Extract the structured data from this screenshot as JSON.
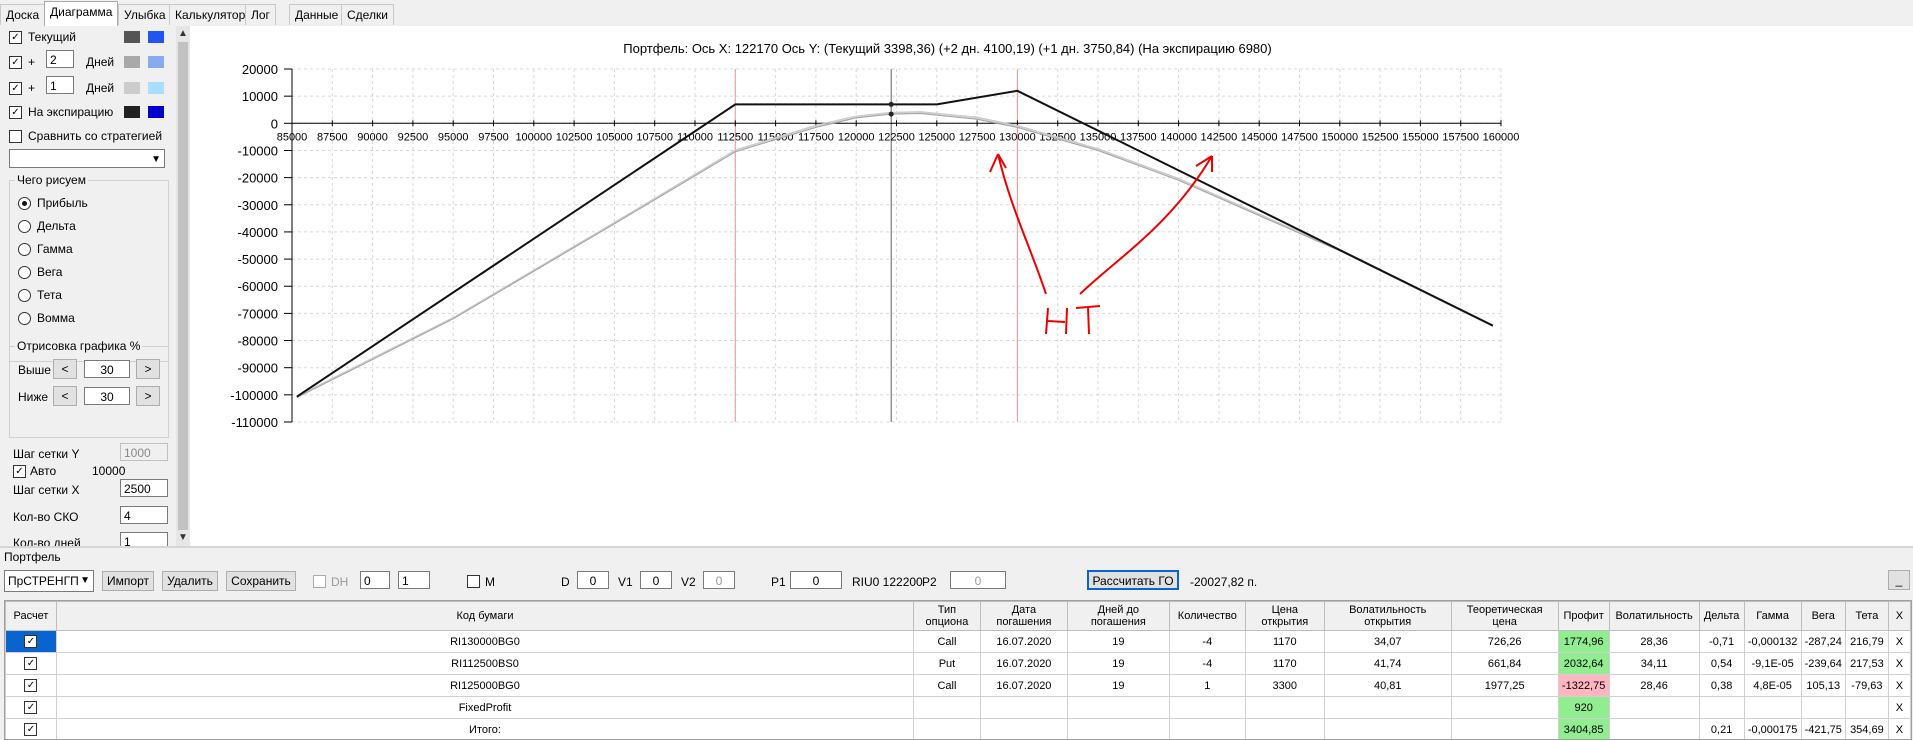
{
  "tabs": [
    "Доска",
    "Диаграмма",
    "Улыбка",
    "Калькулятор",
    "Лог",
    "Данные",
    "Сделки"
  ],
  "active_tab": "Диаграмма",
  "left": {
    "series": [
      {
        "label": "Текущий",
        "checked": true,
        "colors": [
          "#555555",
          "#2255ee"
        ]
      },
      {
        "prefix": "+",
        "days": "2",
        "label": "Дней",
        "checked": true,
        "colors": [
          "#a9a9a9",
          "#88aaee"
        ]
      },
      {
        "prefix": "+",
        "days": "1",
        "label": "Дней",
        "checked": true,
        "colors": [
          "#cccccc",
          "#aaddff"
        ]
      },
      {
        "label": "На экспирацию",
        "checked": true,
        "colors": [
          "#222222",
          "#0000cc"
        ]
      }
    ],
    "compare_label": "Сравнить со стратегией",
    "what_title": "Чего рисуем",
    "radios": [
      "Прибыль",
      "Дельта",
      "Гамма",
      "Вега",
      "Тета",
      "Вомма"
    ],
    "radio_selected": 0,
    "render_title": "Отрисовка графика %",
    "above_label": "Выше",
    "above_value": "30",
    "below_label": "Ниже",
    "below_value": "30",
    "left_arrow": "<",
    "right_arrow": ">",
    "grid_y_label": "Шаг сетки Y",
    "grid_y_value": "1000",
    "auto_label": "Авто",
    "auto_value": "10000",
    "grid_x_label": "Шаг сетки X",
    "grid_x_value": "2500",
    "sko_label": "Кол-во СКО",
    "sko_value": "4",
    "days_label": "Кол-во дней",
    "days_value": "1"
  },
  "chart": {
    "header": "Портфель: Ось X:  122170 Ось Y:   (Текущий 3398,36)  (+2 дн. 4100,19)  (+1 дн. 3750,84)  (На экспирацию 6980)"
  },
  "chart_data": {
    "type": "line",
    "title": "Портфель: Ось X:  122170 Ось Y:   (Текущий 3398,36)  (+2 дн. 4100,19)  (+1 дн. 3750,84)  (На экспирацию 6980)",
    "xlim": [
      85000,
      160000
    ],
    "ylim": [
      -110000,
      20000
    ],
    "x_ticks": [
      85000,
      87500,
      90000,
      92500,
      95000,
      97500,
      100000,
      102500,
      105000,
      107500,
      110000,
      112500,
      115000,
      117500,
      120000,
      122500,
      125000,
      127500,
      130000,
      132500,
      135000,
      137500,
      140000,
      142500,
      145000,
      147500,
      150000,
      152500,
      155000,
      157500,
      160000
    ],
    "y_ticks": [
      20000,
      10000,
      0,
      -10000,
      -20000,
      -30000,
      -40000,
      -50000,
      -60000,
      -70000,
      -80000,
      -90000,
      -100000,
      -110000
    ],
    "grid": true,
    "series": [
      {
        "color": "#111111",
        "width": 2,
        "points": [
          [
            85300,
            -100700
          ],
          [
            112500,
            6980
          ],
          [
            125000,
            6980
          ],
          [
            130000,
            11980
          ],
          [
            159500,
            -74500
          ]
        ]
      },
      {
        "color": "#a0a0a0",
        "width": 1,
        "points": [
          [
            85300,
            -101000
          ],
          [
            95000,
            -72000
          ],
          [
            105000,
            -37000
          ],
          [
            112500,
            -10500
          ],
          [
            117500,
            -1500
          ],
          [
            120000,
            2000
          ],
          [
            122170,
            3398
          ],
          [
            124000,
            3600
          ],
          [
            127500,
            1500
          ],
          [
            130000,
            -1500
          ],
          [
            135000,
            -10000
          ],
          [
            140000,
            -21000
          ],
          [
            150000,
            -47000
          ],
          [
            159500,
            -74800
          ]
        ]
      },
      {
        "color": "#c8c8c8",
        "width": 1,
        "points": [
          [
            85300,
            -100500
          ],
          [
            95000,
            -71500
          ],
          [
            105000,
            -36500
          ],
          [
            112500,
            -9800
          ],
          [
            117500,
            -700
          ],
          [
            120000,
            2700
          ],
          [
            122170,
            4100
          ],
          [
            124000,
            4300
          ],
          [
            127500,
            2300
          ],
          [
            130000,
            -800
          ],
          [
            135000,
            -9300
          ],
          [
            140000,
            -20300
          ],
          [
            150000,
            -46500
          ],
          [
            159500,
            -74600
          ]
        ]
      },
      {
        "color": "#d0d0d0",
        "width": 1,
        "points": [
          [
            85300,
            -100600
          ],
          [
            95000,
            -71700
          ],
          [
            105000,
            -36700
          ],
          [
            112500,
            -10100
          ],
          [
            117500,
            -1100
          ],
          [
            120000,
            2300
          ],
          [
            122170,
            3751
          ],
          [
            124000,
            3950
          ],
          [
            127500,
            1900
          ],
          [
            130000,
            -1100
          ],
          [
            135000,
            -9600
          ],
          [
            140000,
            -20600
          ],
          [
            150000,
            -46700
          ],
          [
            159500,
            -74700
          ]
        ]
      }
    ],
    "vlines": [
      {
        "x": 112500,
        "color": "#ff9090"
      },
      {
        "x": 122170,
        "color": "#606060"
      },
      {
        "x": 130000,
        "color": "#ff9090"
      }
    ],
    "markers": [
      {
        "x": 122170,
        "y": 6980
      },
      {
        "x": 122170,
        "y": 3398
      }
    ]
  },
  "annotation": {
    "text": "HT"
  },
  "portfolio": {
    "label": "Портфель",
    "select_value": "ПрСТРЕНГП",
    "import": "Импорт",
    "delete": "Удалить",
    "save": "Сохранить",
    "dh": "DH",
    "spin1": "0",
    "spin2": "1",
    "m": "M",
    "d_label": "D",
    "d_value": "0",
    "v1_label": "V1",
    "v1_value": "0",
    "v2_label": "V2",
    "v2_value": "0",
    "p1_label": "P1",
    "p1_value": "0",
    "riu_text": "RIU0 122200",
    "p2_label": "P2",
    "p2_value": "0",
    "calc_go": "Рассчитать ГО",
    "go_value": "-20027,82 п.",
    "min_btn": "_"
  },
  "table": {
    "headers": [
      "Расчет",
      "Код бумаги",
      "Тип опциона",
      "Дата погашения",
      "Дней до погашения",
      "Количество",
      "Цена открытия",
      "Волатильность открытия",
      "Теоретическая цена",
      "Профит",
      "Волатильность",
      "Дельта",
      "Гамма",
      "Вега",
      "Тета",
      "X"
    ],
    "rows": [
      {
        "checked": true,
        "code": "RI130000BG0",
        "type": "Call",
        "date": "16.07.2020",
        "days": "19",
        "qty": "-4",
        "open": "1170",
        "vol_open": "34,07",
        "theo": "726,26",
        "profit": "1774,96",
        "profit_color": "green",
        "vol": "28,36",
        "delta": "-0,71",
        "gamma": "-0,000132",
        "vega": "-287,24",
        "theta": "216,79",
        "x": "X"
      },
      {
        "checked": true,
        "code": "RI112500BS0",
        "type": "Put",
        "date": "16.07.2020",
        "days": "19",
        "qty": "-4",
        "open": "1170",
        "vol_open": "41,74",
        "theo": "661,84",
        "profit": "2032,64",
        "profit_color": "green",
        "vol": "34,11",
        "delta": "0,54",
        "gamma": "-9,1E-05",
        "vega": "-239,64",
        "theta": "217,53",
        "x": "X"
      },
      {
        "checked": true,
        "code": "RI125000BG0",
        "type": "Call",
        "date": "16.07.2020",
        "days": "19",
        "qty": "1",
        "open": "3300",
        "vol_open": "40,81",
        "theo": "1977,25",
        "profit": "-1322,75",
        "profit_color": "red",
        "vol": "28,46",
        "delta": "0,38",
        "gamma": "4,8E-05",
        "vega": "105,13",
        "theta": "-79,63",
        "x": "X"
      },
      {
        "checked": true,
        "code": "FixedProfit",
        "type": "",
        "date": "",
        "days": "",
        "qty": "",
        "open": "",
        "vol_open": "",
        "theo": "",
        "profit": "920",
        "profit_color": "green",
        "vol": "",
        "delta": "",
        "gamma": "",
        "vega": "",
        "theta": "",
        "x": "X"
      },
      {
        "checked": true,
        "code": "Итого:",
        "type": "",
        "date": "",
        "days": "",
        "qty": "",
        "open": "",
        "vol_open": "",
        "theo": "",
        "profit": "3404,85",
        "profit_color": "green",
        "vol": "",
        "delta": "0,21",
        "gamma": "-0,000175",
        "vega": "-421,75",
        "theta": "354,69",
        "x": "X"
      }
    ]
  }
}
